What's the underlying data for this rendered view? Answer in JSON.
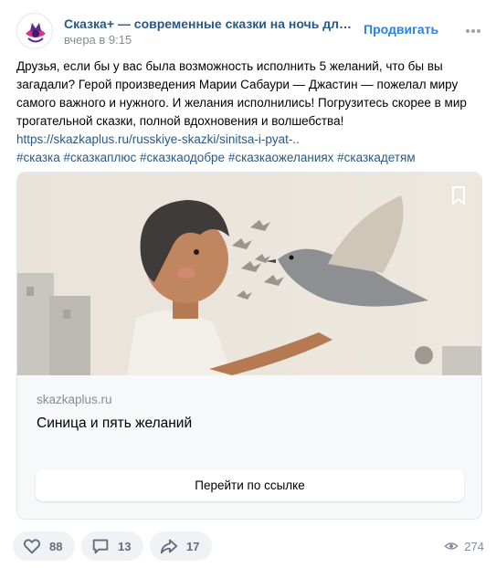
{
  "post": {
    "author": "Сказка+ — современные сказки на ночь для де...",
    "time": "вчера в 9:15",
    "promote_label": "Продвигать",
    "text": "Друзья, если бы у вас была возможность исполнить 5 желаний, что бы вы загадали? Герой произведения Марии Сабаури — Джастин — пожелал миру самого важного и нужного. И желания исполнились! Погрузитесь скорее в мир трогательной сказки, полной вдохновения и волшебства!",
    "link": "https://skazkaplus.ru/russkiye-skazki/sinitsa-i-pyat-..",
    "hashtags": "#сказка #сказкаплюс #сказкаодобре #сказкаожеланиях #сказкадетям"
  },
  "card": {
    "domain": "skazkaplus.ru",
    "title": "Синица и пять желаний",
    "button_label": "Перейти по ссылке"
  },
  "actions": {
    "likes": "88",
    "comments": "13",
    "shares": "17",
    "views": "274"
  },
  "icons": {
    "avatar": "skazka-logo",
    "more": "ellipsis-icon",
    "bookmark": "bookmark-icon",
    "like": "heart-icon",
    "comment": "comment-icon",
    "share": "share-icon",
    "views": "eye-icon"
  },
  "colors": {
    "link": "#2a5885",
    "accent": "#2d81e0",
    "muted": "#818c99"
  }
}
